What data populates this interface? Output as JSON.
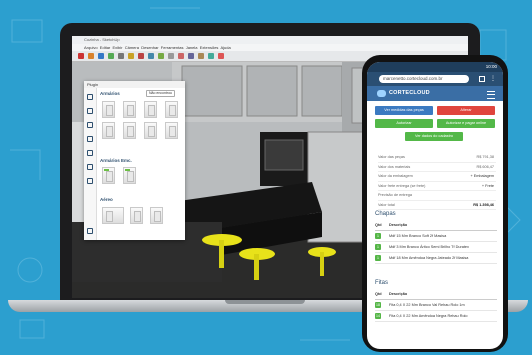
{
  "laptop": {
    "window_title": "Cozinha - SketchUp",
    "menu": [
      "Arquivo",
      "Editar",
      "Exibir",
      "Câmera",
      "Desenhar",
      "Ferramentas",
      "Janela",
      "Extensões",
      "Ajuda"
    ],
    "panel": {
      "header": "Plugin",
      "title1": "Armários",
      "button": "Não encontrou",
      "title2": "Armários Emc.",
      "title3": "Aéreo"
    }
  },
  "phone": {
    "status_time": "10:00",
    "url": "marcenetto.cortecloud.com.br",
    "brand": "CORTECLOUD",
    "buttons": {
      "view_parts": "Ver medidas das peças",
      "change": "Alterar",
      "approve": "Autorizar",
      "approve_pay": "Autorizar e pagar online",
      "view_data": "Ver dados do cadastro"
    },
    "summary": [
      {
        "label": "Valor das peças",
        "value": "R$ 791,38"
      },
      {
        "label": "Valor dos materiais",
        "value": "R$ 606,47"
      },
      {
        "label": "Valor da embalagem",
        "value": "+ Embalagem"
      },
      {
        "label": "Valor frete entrega (se frete)",
        "value": "+ Frete"
      },
      {
        "label": "Previsão de entrega",
        "value": ""
      },
      {
        "label": "Valor total",
        "value": "R$ 1.398,46"
      }
    ],
    "section_chapas": "Chapas",
    "table_head": {
      "qtd": "Qtd",
      "desc": "Descrição"
    },
    "chapas": [
      {
        "qtd": "1",
        "desc": "Mdf 15 Mm Branco Soft 2f Masisa"
      },
      {
        "qtd": "1",
        "desc": "Mdf 3 Mm Branco Ártico Semi Brilho Tf Duratex"
      },
      {
        "qtd": "1",
        "desc": "Mdf 18 Mm Amêndoa Negra Jateado 2f Masisa"
      }
    ],
    "section_fitas": "Fitas",
    "fitas": [
      {
        "qtd": "18",
        "desc": "Fita 0,4 X 22 Mm Branco Val Rehau Rolo 1m"
      },
      {
        "qtd": "14",
        "desc": "Fita 0,4 X 22 Mm Amêndoa Negra Rehau Rolo"
      }
    ]
  },
  "colors": {
    "background": "#2c9fcf",
    "brand_blue": "#3a6ea5",
    "btn_blue": "#3b7ac1",
    "btn_red": "#e0453d",
    "btn_green": "#53b848"
  }
}
